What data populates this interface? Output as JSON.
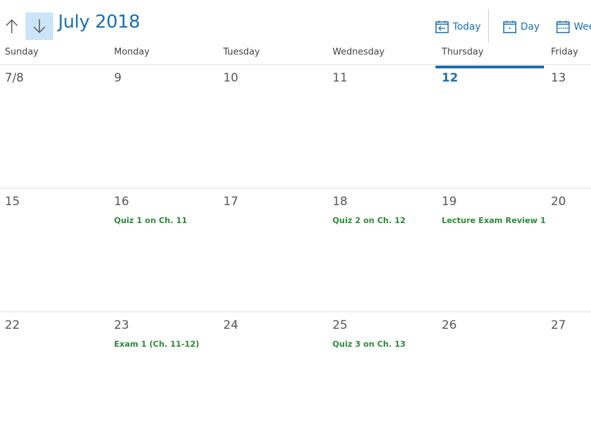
{
  "header": {
    "month_title": "July 2018",
    "buttons": {
      "today": "Today",
      "day": "Day",
      "week": "Week"
    }
  },
  "weekdays": [
    "Sunday",
    "Monday",
    "Tuesday",
    "Wednesday",
    "Thursday",
    "Friday"
  ],
  "weeks": [
    {
      "days": [
        {
          "label": "7/8",
          "events": []
        },
        {
          "label": "9",
          "events": []
        },
        {
          "label": "10",
          "events": []
        },
        {
          "label": "11",
          "events": []
        },
        {
          "label": "12",
          "today": true,
          "events": []
        },
        {
          "label": "13",
          "events": []
        }
      ]
    },
    {
      "days": [
        {
          "label": "15",
          "events": []
        },
        {
          "label": "16",
          "events": [
            "Quiz 1 on Ch. 11"
          ]
        },
        {
          "label": "17",
          "events": []
        },
        {
          "label": "18",
          "events": [
            "Quiz 2 on Ch. 12"
          ]
        },
        {
          "label": "19",
          "events": [
            "Lecture Exam Review 1"
          ]
        },
        {
          "label": "20",
          "events": []
        }
      ]
    },
    {
      "days": [
        {
          "label": "22",
          "events": []
        },
        {
          "label": "23",
          "events": [
            "Exam 1 (Ch. 11-12)"
          ]
        },
        {
          "label": "24",
          "events": []
        },
        {
          "label": "25",
          "events": [
            "Quiz 3 on Ch. 13"
          ]
        },
        {
          "label": "26",
          "events": []
        },
        {
          "label": "27",
          "events": []
        }
      ]
    }
  ],
  "colors": {
    "accent": "#1a6fb0",
    "event_text": "#2f8a3a",
    "selected_button_bg": "#cce4f7"
  }
}
